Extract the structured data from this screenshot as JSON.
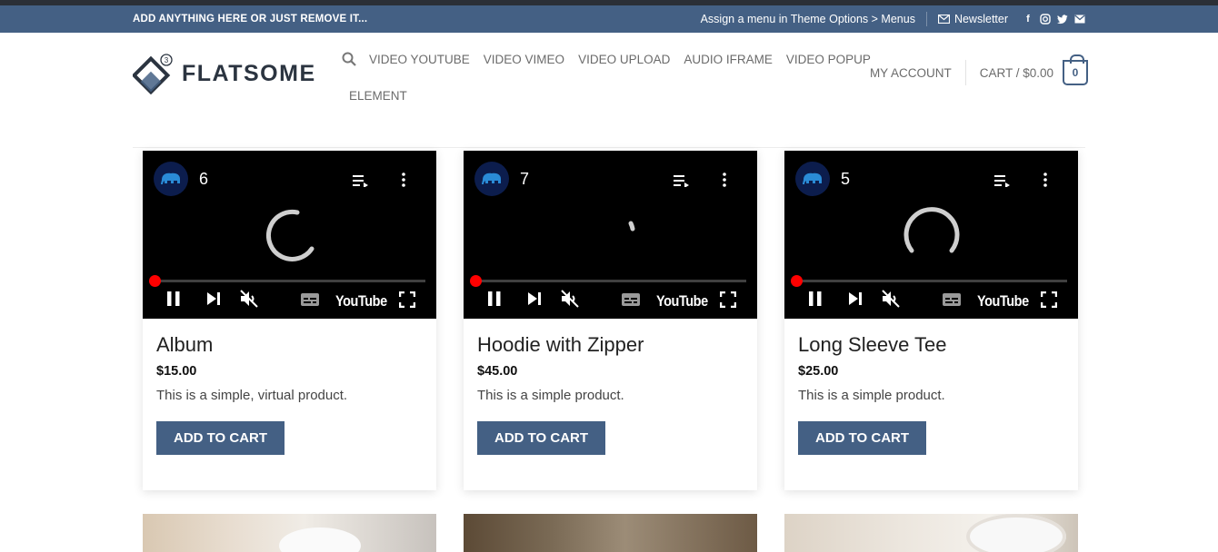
{
  "topbar": {
    "left_text": "ADD ANYTHING HERE OR JUST REMOVE IT...",
    "menu_hint": "Assign a menu in Theme Options > Menus",
    "newsletter": "Newsletter"
  },
  "header": {
    "logo_text": "FLATSOME",
    "nav": [
      "VIDEO YOUTUBE",
      "VIDEO VIMEO",
      "VIDEO UPLOAD",
      "AUDIO IFRAME",
      "VIDEO POPUP",
      "ELEMENT"
    ],
    "account": "MY ACCOUNT",
    "cart": "CART / $0.00",
    "cart_count": "0"
  },
  "colors": {
    "accent": "#446084",
    "progress_red": "#ff0000"
  },
  "products": [
    {
      "video_num": "6",
      "name": "Album",
      "price": "$15.00",
      "desc": "This is a simple, virtual product.",
      "button": "ADD TO CART"
    },
    {
      "video_num": "7",
      "name": "Hoodie with Zipper",
      "price": "$45.00",
      "desc": "This is a simple product.",
      "button": "ADD TO CART"
    },
    {
      "video_num": "5",
      "name": "Long Sleeve Tee",
      "price": "$25.00",
      "desc": "This is a simple product.",
      "button": "ADD TO CART"
    }
  ],
  "video_brand": "YouTube"
}
